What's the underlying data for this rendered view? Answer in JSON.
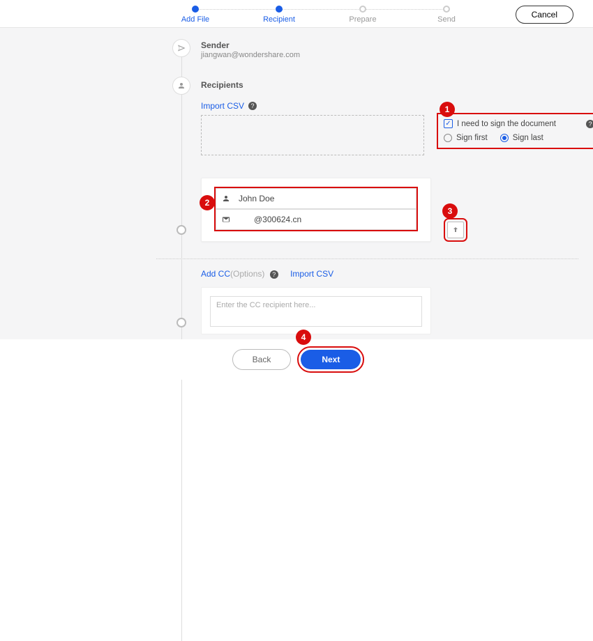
{
  "header": {
    "steps": [
      {
        "label": "Add File",
        "state": "done"
      },
      {
        "label": "Recipient",
        "state": "active"
      },
      {
        "label": "Prepare",
        "state": "pending"
      },
      {
        "label": "Send",
        "state": "pending"
      }
    ],
    "cancel_label": "Cancel"
  },
  "sender": {
    "title": "Sender",
    "email": "jiangwan@wondershare.com"
  },
  "recipients": {
    "title": "Recipients",
    "import_csv_label": "Import CSV",
    "sign_options": {
      "need_sign_label": "I need to sign the document",
      "need_sign_checked": true,
      "first_label": "Sign first",
      "last_label": "Sign last",
      "selected": "last"
    },
    "entries": [
      {
        "name": "John Doe",
        "email": "@300624.cn"
      }
    ]
  },
  "cc": {
    "add_label": "Add CC",
    "options_suffix": "(Options)",
    "import_csv_label": "Import CSV",
    "placeholder": "Enter the CC recipient here..."
  },
  "footer": {
    "back_label": "Back",
    "next_label": "Next"
  },
  "annotations": {
    "b1": "1",
    "b2": "2",
    "b3": "3",
    "b4": "4"
  },
  "colors": {
    "accent": "#1a5de6",
    "danger": "#d90d0d"
  }
}
